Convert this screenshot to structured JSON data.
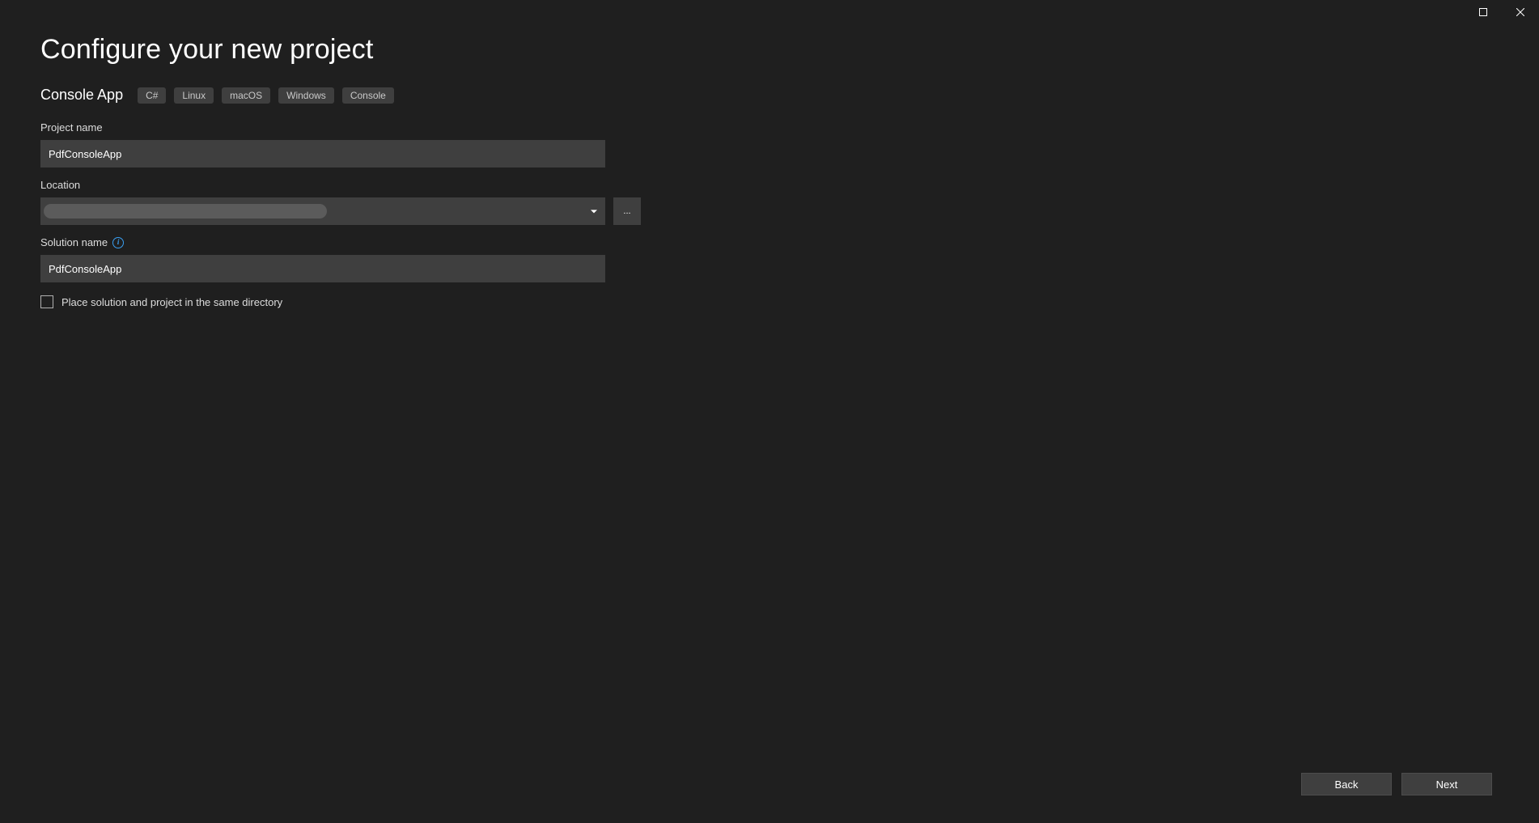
{
  "titlebar": {
    "maximize_tooltip": "Maximize",
    "close_tooltip": "Close"
  },
  "header": {
    "title": "Configure your new project",
    "subtitle": "Console App",
    "tags": [
      "C#",
      "Linux",
      "macOS",
      "Windows",
      "Console"
    ]
  },
  "form": {
    "project_name": {
      "label": "Project name",
      "value": "PdfConsoleApp"
    },
    "location": {
      "label": "Location",
      "value": "",
      "browse_label": "..."
    },
    "solution_name": {
      "label": "Solution name",
      "value": "PdfConsoleApp",
      "info_icon": "i"
    },
    "same_directory": {
      "label": "Place solution and project in the same directory",
      "checked": false
    }
  },
  "footer": {
    "back_label": "Back",
    "next_label": "Next"
  }
}
